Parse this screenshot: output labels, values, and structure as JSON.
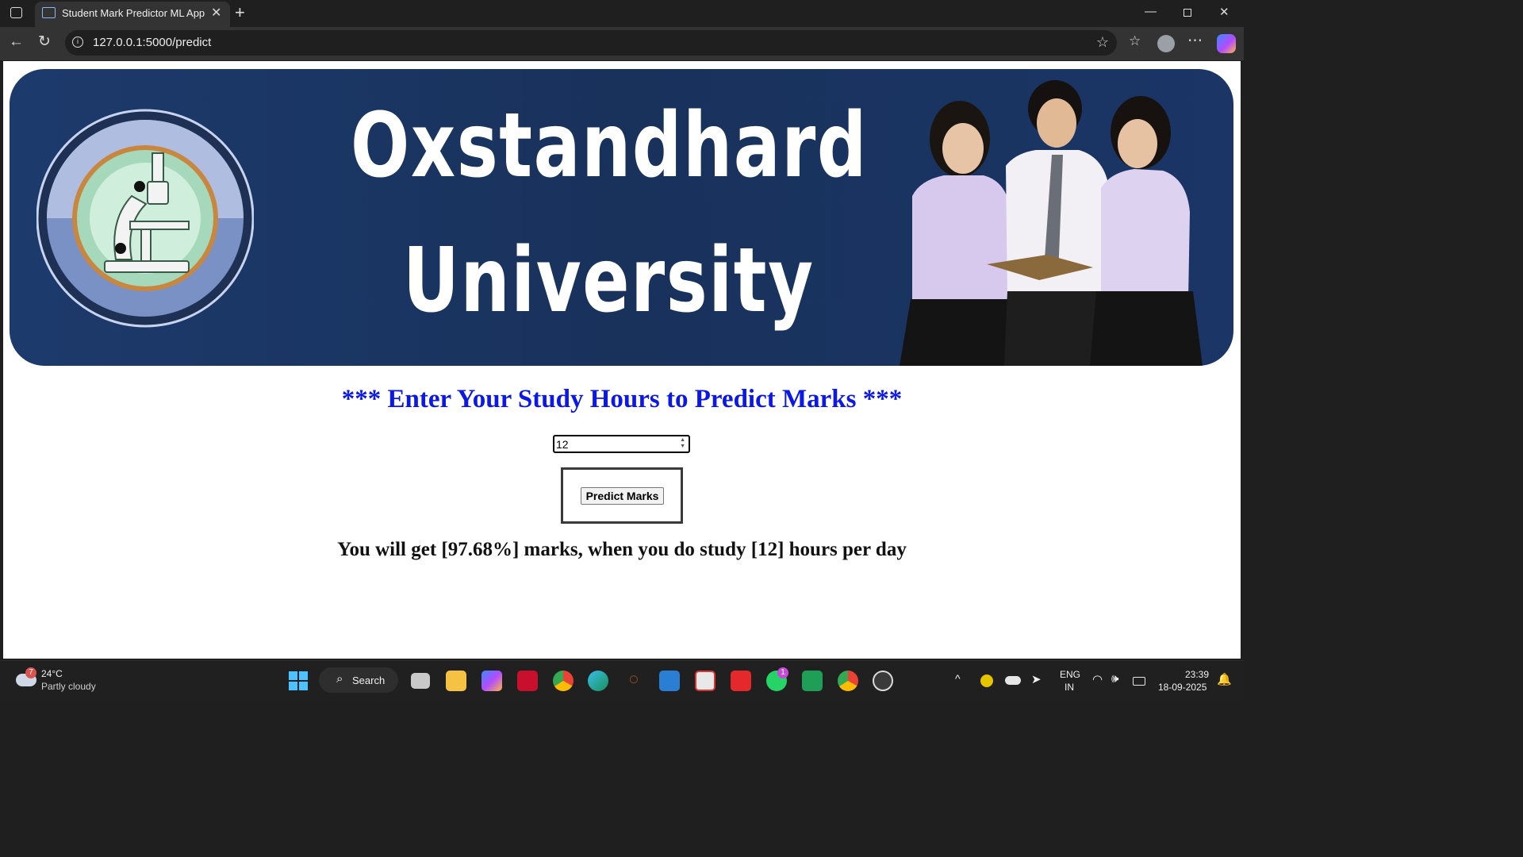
{
  "browser": {
    "tab_title": "Student Mark Predictor ML App",
    "url": "127.0.0.1:5000/predict"
  },
  "page": {
    "banner": {
      "line1": "Oxstandhard",
      "line2": "University"
    },
    "heading": "*** Enter Your Study Hours to Predict Marks ***",
    "hours_value": "12",
    "predict_button": "Predict Marks",
    "result": "You will get [97.68%] marks, when you do study [12] hours per day"
  },
  "taskbar": {
    "weather_badge": "7",
    "temperature": "24°C",
    "weather": "Partly cloudy",
    "search_label": "Search",
    "whatsapp_badge": "1",
    "lang_line1": "ENG",
    "lang_line2": "IN",
    "time": "23:39",
    "date": "18-09-2025"
  },
  "colors": {
    "heading": "#0b18e8",
    "banner": "#1a3566",
    "browser_chrome": "#333333"
  }
}
